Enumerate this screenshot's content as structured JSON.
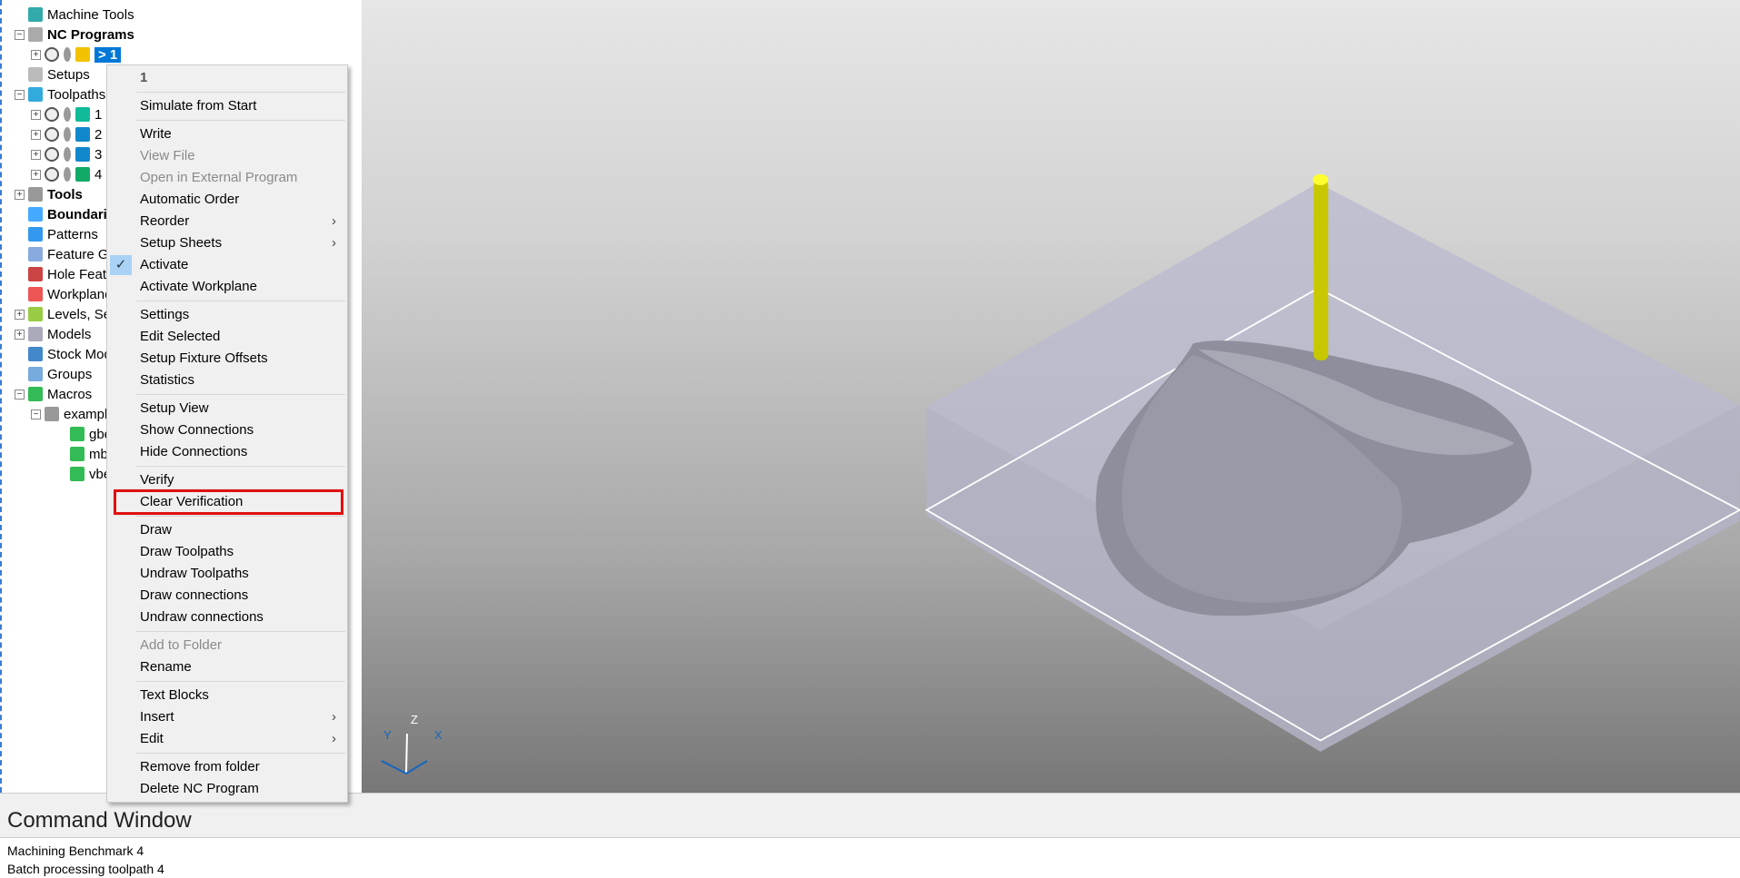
{
  "tree": [
    {
      "label": "Machine Tools",
      "level": 0,
      "bold": false,
      "exp": "",
      "icon": "machine-tools-icon",
      "color": "#3aa"
    },
    {
      "label": "NC Programs",
      "level": 0,
      "bold": true,
      "exp": "−",
      "icon": "nc-programs-icon",
      "color": "#aaa"
    },
    {
      "label": "> 1",
      "level": 1,
      "bold": false,
      "exp": "+",
      "icon": "nc-program-icon",
      "color": "#f2c200",
      "selected": true
    },
    {
      "label": "Setups",
      "level": 0,
      "bold": false,
      "exp": "",
      "icon": "setups-icon",
      "color": "#bbb"
    },
    {
      "label": "Toolpaths",
      "level": 0,
      "bold": false,
      "exp": "−",
      "icon": "toolpaths-icon",
      "color": "#3ad"
    },
    {
      "label": "1",
      "level": 1,
      "bold": false,
      "exp": "+",
      "icon": "toolpath-icon",
      "color": "#1b9"
    },
    {
      "label": "2",
      "level": 1,
      "bold": false,
      "exp": "+",
      "icon": "toolpath-icon",
      "color": "#18c"
    },
    {
      "label": "3",
      "level": 1,
      "bold": false,
      "exp": "+",
      "icon": "toolpath-icon",
      "color": "#18c"
    },
    {
      "label": "4",
      "level": 1,
      "bold": false,
      "exp": "+",
      "icon": "toolpath-icon",
      "color": "#1a6"
    },
    {
      "label": "Tools",
      "level": 0,
      "bold": true,
      "exp": "+",
      "icon": "tools-icon",
      "color": "#999"
    },
    {
      "label": "Boundaries",
      "level": 0,
      "bold": true,
      "exp": "",
      "icon": "boundaries-icon",
      "color": "#4af"
    },
    {
      "label": "Patterns",
      "level": 0,
      "bold": false,
      "exp": "",
      "icon": "patterns-icon",
      "color": "#39e"
    },
    {
      "label": "Feature Groups",
      "level": 0,
      "bold": false,
      "exp": "",
      "icon": "feature-groups-icon",
      "color": "#8ad"
    },
    {
      "label": "Hole Feature Sets",
      "level": 0,
      "bold": false,
      "exp": "",
      "icon": "hole-features-icon",
      "color": "#c44"
    },
    {
      "label": "Workplanes",
      "level": 0,
      "bold": false,
      "exp": "",
      "icon": "workplanes-icon",
      "color": "#e55"
    },
    {
      "label": "Levels, Sets",
      "level": 0,
      "bold": false,
      "exp": "+",
      "icon": "levels-icon",
      "color": "#9c4"
    },
    {
      "label": "Models",
      "level": 0,
      "bold": false,
      "exp": "+",
      "icon": "models-icon",
      "color": "#aab"
    },
    {
      "label": "Stock Models",
      "level": 0,
      "bold": false,
      "exp": "",
      "icon": "stock-models-icon",
      "color": "#48c"
    },
    {
      "label": "Groups",
      "level": 0,
      "bold": false,
      "exp": "",
      "icon": "groups-icon",
      "color": "#7ad"
    },
    {
      "label": "Macros",
      "level": 0,
      "bold": false,
      "exp": "−",
      "icon": "macros-icon",
      "color": "#3b5"
    },
    {
      "label": "examples",
      "level": 1,
      "bold": false,
      "exp": "−",
      "icon": "macro-folder-icon",
      "color": "#999"
    },
    {
      "label": "gbenchmark",
      "level": 2,
      "bold": false,
      "exp": "",
      "icon": "macro-icon",
      "color": "#3b5"
    },
    {
      "label": "mbenchmark",
      "level": 2,
      "bold": false,
      "exp": "",
      "icon": "macro-icon",
      "color": "#3b5"
    },
    {
      "label": "vbenchmark",
      "level": 2,
      "bold": false,
      "exp": "",
      "icon": "macro-icon",
      "color": "#3b5"
    }
  ],
  "menu": [
    {
      "t": "item",
      "label": "1",
      "hdr": true
    },
    {
      "t": "sep"
    },
    {
      "t": "item",
      "label": "Simulate from Start"
    },
    {
      "t": "sep"
    },
    {
      "t": "item",
      "label": "Write"
    },
    {
      "t": "item",
      "label": "View File",
      "dis": true
    },
    {
      "t": "item",
      "label": "Open in External Program",
      "dis": true
    },
    {
      "t": "item",
      "label": "Automatic Order"
    },
    {
      "t": "item",
      "label": "Reorder",
      "sub": true
    },
    {
      "t": "item",
      "label": "Setup Sheets",
      "sub": true
    },
    {
      "t": "item",
      "label": "Activate",
      "checked": true
    },
    {
      "t": "item",
      "label": "Activate Workplane"
    },
    {
      "t": "sep"
    },
    {
      "t": "item",
      "label": "Settings"
    },
    {
      "t": "item",
      "label": "Edit Selected"
    },
    {
      "t": "item",
      "label": "Setup Fixture Offsets"
    },
    {
      "t": "item",
      "label": "Statistics"
    },
    {
      "t": "sep"
    },
    {
      "t": "item",
      "label": "Setup View"
    },
    {
      "t": "item",
      "label": "Show Connections"
    },
    {
      "t": "item",
      "label": "Hide Connections"
    },
    {
      "t": "sep"
    },
    {
      "t": "item",
      "label": "Verify"
    },
    {
      "t": "item",
      "label": "Clear Verification",
      "highlight": true
    },
    {
      "t": "sep"
    },
    {
      "t": "item",
      "label": "Draw"
    },
    {
      "t": "item",
      "label": "Draw Toolpaths"
    },
    {
      "t": "item",
      "label": "Undraw Toolpaths"
    },
    {
      "t": "item",
      "label": "Draw connections"
    },
    {
      "t": "item",
      "label": "Undraw connections"
    },
    {
      "t": "sep"
    },
    {
      "t": "item",
      "label": "Add to Folder",
      "dis": true
    },
    {
      "t": "item",
      "label": "Rename"
    },
    {
      "t": "sep"
    },
    {
      "t": "item",
      "label": "Text Blocks"
    },
    {
      "t": "item",
      "label": "Insert",
      "sub": true
    },
    {
      "t": "item",
      "label": "Edit",
      "sub": true
    },
    {
      "t": "sep"
    },
    {
      "t": "item",
      "label": "Remove from folder"
    },
    {
      "t": "item",
      "label": "Delete NC Program"
    }
  ],
  "axes": {
    "x": "X",
    "y": "Y",
    "z": "Z"
  },
  "command_window": {
    "title": "Command Window",
    "lines": [
      "Machining Benchmark 4",
      "Batch processing toolpath 4"
    ]
  },
  "colors": {
    "selection": "#0078d7",
    "highlight_box": "#e01010",
    "tool": "#d4d400"
  }
}
